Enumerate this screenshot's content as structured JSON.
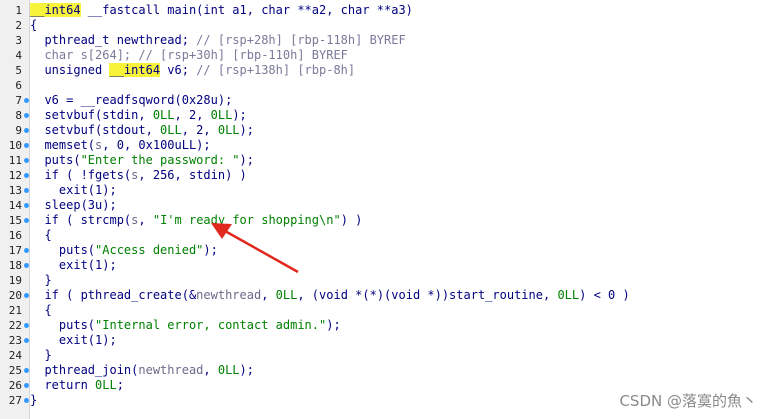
{
  "colors": {
    "keyword": "#000080",
    "comment": "#7a7a9a",
    "string": "#008000",
    "number": "#008000",
    "variable": "#6a6a8a",
    "highlight": "#f7f23a",
    "gutter": "#f0f0f0",
    "arrow": "#e0281e"
  },
  "lines": [
    {
      "n": "1",
      "bp": false,
      "tokens": [
        {
          "t": "__int64",
          "c": "hl"
        },
        {
          "t": " __fastcall main(int a1, char **a2, char **a3)",
          "c": "c-kw"
        }
      ]
    },
    {
      "n": "2",
      "bp": false,
      "tokens": [
        {
          "t": "{",
          "c": "c-pun"
        }
      ]
    },
    {
      "n": "3",
      "bp": false,
      "tokens": [
        {
          "t": "  pthread_t newthread; ",
          "c": "c-kw"
        },
        {
          "t": "// [rsp+28h] [rbp-118h] BYREF",
          "c": "c-cmt"
        }
      ]
    },
    {
      "n": "4",
      "bp": false,
      "tokens": [
        {
          "t": "  char s[264]; ",
          "c": "c-cmt"
        },
        {
          "t": "// [rsp+30h] [rbp-110h] BYREF",
          "c": "c-cmt"
        }
      ]
    },
    {
      "n": "5",
      "bp": false,
      "tokens": [
        {
          "t": "  unsigned ",
          "c": "c-kw"
        },
        {
          "t": "__int64",
          "c": "hl"
        },
        {
          "t": " v6; ",
          "c": "c-kw"
        },
        {
          "t": "// [rsp+138h] [rbp-8h]",
          "c": "c-cmt"
        }
      ]
    },
    {
      "n": "6",
      "bp": false,
      "tokens": []
    },
    {
      "n": "7",
      "bp": true,
      "tokens": [
        {
          "t": "  v6 = __readfsqword(0x28u);",
          "c": "c-kw"
        }
      ]
    },
    {
      "n": "8",
      "bp": true,
      "tokens": [
        {
          "t": "  setvbuf(stdin, ",
          "c": "c-kw"
        },
        {
          "t": "0LL",
          "c": "c-num"
        },
        {
          "t": ", 2, ",
          "c": "c-kw"
        },
        {
          "t": "0LL",
          "c": "c-num"
        },
        {
          "t": ");",
          "c": "c-kw"
        }
      ]
    },
    {
      "n": "9",
      "bp": true,
      "tokens": [
        {
          "t": "  setvbuf(stdout, ",
          "c": "c-kw"
        },
        {
          "t": "0LL",
          "c": "c-num"
        },
        {
          "t": ", 2, ",
          "c": "c-kw"
        },
        {
          "t": "0LL",
          "c": "c-num"
        },
        {
          "t": ");",
          "c": "c-kw"
        }
      ]
    },
    {
      "n": "10",
      "bp": true,
      "tokens": [
        {
          "t": "  memset(",
          "c": "c-kw"
        },
        {
          "t": "s",
          "c": "c-var"
        },
        {
          "t": ", 0, 0x100uLL);",
          "c": "c-kw"
        }
      ]
    },
    {
      "n": "11",
      "bp": true,
      "tokens": [
        {
          "t": "  puts(",
          "c": "c-kw"
        },
        {
          "t": "\"Enter the password: \"",
          "c": "c-str"
        },
        {
          "t": ");",
          "c": "c-kw"
        }
      ]
    },
    {
      "n": "12",
      "bp": true,
      "tokens": [
        {
          "t": "  if ( !fgets(",
          "c": "c-kw"
        },
        {
          "t": "s",
          "c": "c-var"
        },
        {
          "t": ", 256, stdin) )",
          "c": "c-kw"
        }
      ]
    },
    {
      "n": "13",
      "bp": true,
      "tokens": [
        {
          "t": "    exit(1);",
          "c": "c-kw"
        }
      ]
    },
    {
      "n": "14",
      "bp": true,
      "tokens": [
        {
          "t": "  sleep(3u);",
          "c": "c-kw"
        }
      ]
    },
    {
      "n": "15",
      "bp": true,
      "tokens": [
        {
          "t": "  if ( strcmp(",
          "c": "c-kw"
        },
        {
          "t": "s",
          "c": "c-var"
        },
        {
          "t": ", ",
          "c": "c-kw"
        },
        {
          "t": "\"I'm ready for shopping\\n\"",
          "c": "c-str"
        },
        {
          "t": ") )",
          "c": "c-kw"
        }
      ]
    },
    {
      "n": "16",
      "bp": false,
      "tokens": [
        {
          "t": "  {",
          "c": "c-pun"
        }
      ]
    },
    {
      "n": "17",
      "bp": true,
      "tokens": [
        {
          "t": "    puts(",
          "c": "c-kw"
        },
        {
          "t": "\"Access denied\"",
          "c": "c-str"
        },
        {
          "t": ");",
          "c": "c-kw"
        }
      ]
    },
    {
      "n": "18",
      "bp": true,
      "tokens": [
        {
          "t": "    exit(1);",
          "c": "c-kw"
        }
      ]
    },
    {
      "n": "19",
      "bp": false,
      "tokens": [
        {
          "t": "  }",
          "c": "c-pun"
        }
      ]
    },
    {
      "n": "20",
      "bp": true,
      "tokens": [
        {
          "t": "  if ( pthread_create(&",
          "c": "c-kw"
        },
        {
          "t": "newthread",
          "c": "c-var"
        },
        {
          "t": ", ",
          "c": "c-kw"
        },
        {
          "t": "0LL",
          "c": "c-num"
        },
        {
          "t": ", (void *(*)(void *))start_routine, ",
          "c": "c-kw"
        },
        {
          "t": "0LL",
          "c": "c-num"
        },
        {
          "t": ") < 0 )",
          "c": "c-kw"
        }
      ]
    },
    {
      "n": "21",
      "bp": false,
      "tokens": [
        {
          "t": "  {",
          "c": "c-pun"
        }
      ]
    },
    {
      "n": "22",
      "bp": true,
      "tokens": [
        {
          "t": "    puts(",
          "c": "c-kw"
        },
        {
          "t": "\"Internal error, contact admin.\"",
          "c": "c-str"
        },
        {
          "t": ");",
          "c": "c-kw"
        }
      ]
    },
    {
      "n": "23",
      "bp": true,
      "tokens": [
        {
          "t": "    exit(1);",
          "c": "c-kw"
        }
      ]
    },
    {
      "n": "24",
      "bp": false,
      "tokens": [
        {
          "t": "  }",
          "c": "c-pun"
        }
      ]
    },
    {
      "n": "25",
      "bp": true,
      "tokens": [
        {
          "t": "  pthread_join(",
          "c": "c-kw"
        },
        {
          "t": "newthread",
          "c": "c-var"
        },
        {
          "t": ", ",
          "c": "c-kw"
        },
        {
          "t": "0LL",
          "c": "c-num"
        },
        {
          "t": ");",
          "c": "c-kw"
        }
      ]
    },
    {
      "n": "26",
      "bp": true,
      "tokens": [
        {
          "t": "  return ",
          "c": "c-kw"
        },
        {
          "t": "0LL",
          "c": "c-num"
        },
        {
          "t": ";",
          "c": "c-kw"
        }
      ]
    },
    {
      "n": "27",
      "bp": true,
      "tokens": [
        {
          "t": "}",
          "c": "c-pun"
        }
      ]
    }
  ],
  "watermark": "CSDN @落寞的魚丶"
}
